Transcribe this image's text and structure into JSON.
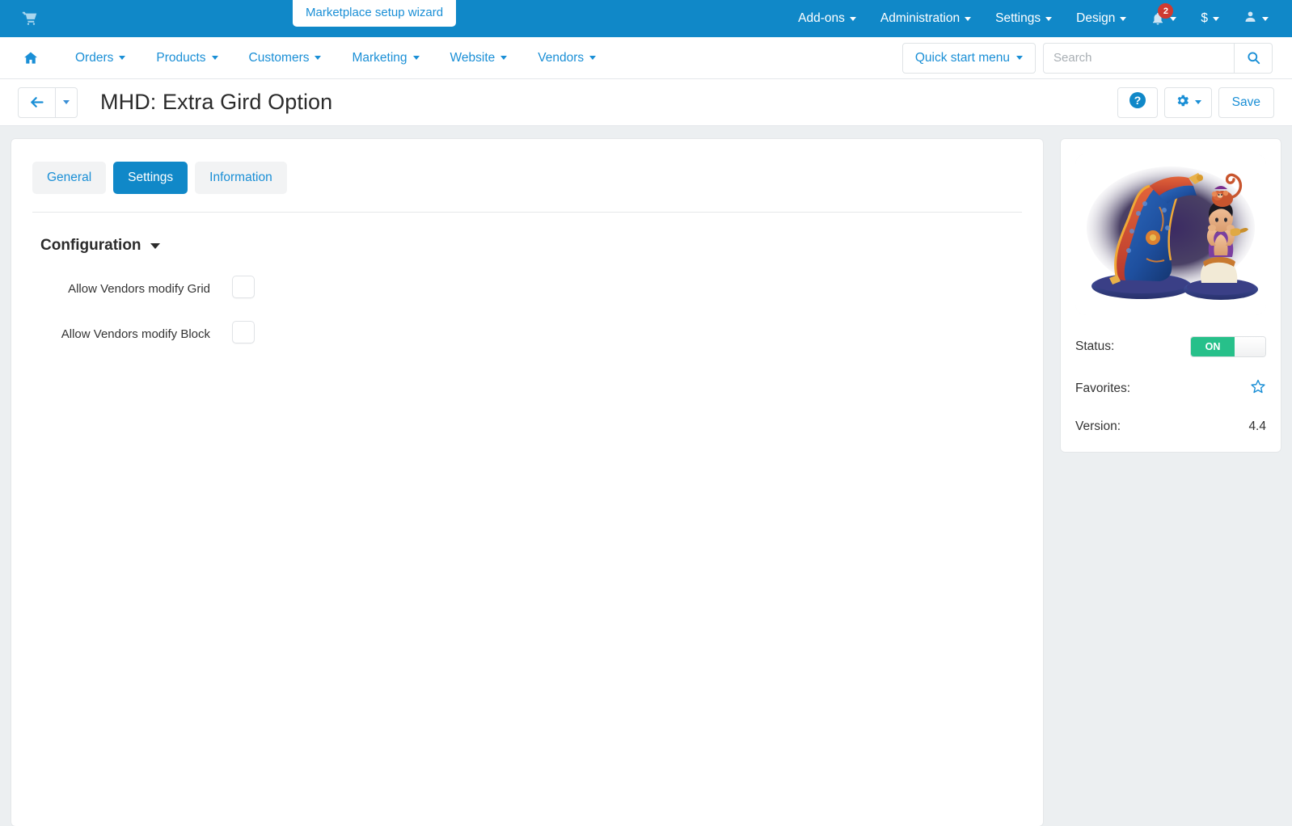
{
  "topbar": {
    "cart_icon": "shopping-cart-icon",
    "wizard_label": "Marketplace setup wizard",
    "menus": [
      {
        "label": "Add-ons"
      },
      {
        "label": "Administration"
      },
      {
        "label": "Settings"
      },
      {
        "label": "Design"
      }
    ],
    "notifications": {
      "icon": "bell-icon",
      "count": "2"
    },
    "currency": {
      "icon": "dollar-icon",
      "label": "$"
    },
    "account": {
      "icon": "user-icon"
    }
  },
  "mainnav": {
    "home_icon": "home-icon",
    "items": [
      {
        "label": "Orders"
      },
      {
        "label": "Products"
      },
      {
        "label": "Customers"
      },
      {
        "label": "Marketing"
      },
      {
        "label": "Website"
      },
      {
        "label": "Vendors"
      }
    ],
    "quick_start": "Quick start menu",
    "search": {
      "placeholder": "Search",
      "value": "",
      "icon": "search-icon"
    }
  },
  "titlebar": {
    "back_icon": "arrow-left-icon",
    "title": "MHD: Extra Gird Option",
    "help_icon": "question-circle-icon",
    "gear_icon": "gear-icon",
    "save_label": "Save"
  },
  "tabs": [
    {
      "label": "General",
      "active": false
    },
    {
      "label": "Settings",
      "active": true
    },
    {
      "label": "Information",
      "active": false
    }
  ],
  "section": {
    "title": "Configuration",
    "collapse_icon": "chevron-down-icon",
    "fields": [
      {
        "label": "Allow Vendors modify Grid",
        "checked": false
      },
      {
        "label": "Allow Vendors modify Block",
        "checked": false
      }
    ]
  },
  "sidebar": {
    "addon_image_alt": "aladdin-figurine-image",
    "status_label": "Status:",
    "status_value": "ON",
    "favorites_label": "Favorites:",
    "favorites_icon": "star-icon",
    "version_label": "Version:",
    "version_value": "4.4"
  },
  "colors": {
    "header_blue": "#1088c8",
    "link_blue": "#1a8fd6",
    "badge_red": "#cf3b31",
    "toggle_green": "#27c08a",
    "page_bg": "#eceff1"
  }
}
